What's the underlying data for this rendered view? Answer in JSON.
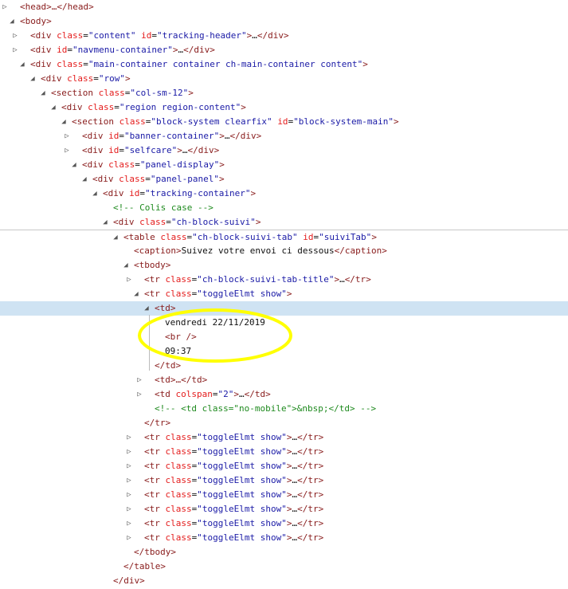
{
  "lines": [
    {
      "level": 0,
      "toggle": "closed",
      "text": "<head>…</head>"
    },
    {
      "level": 0,
      "toggle": "open",
      "text": "<body>"
    },
    {
      "level": 1,
      "toggle": "closed",
      "text": "<div class=\"content\" id=\"tracking-header\">…</div>"
    },
    {
      "level": 1,
      "toggle": "closed",
      "text": "<div id=\"navmenu-container\">…</div>"
    },
    {
      "level": 1,
      "toggle": "open",
      "text": "<div class=\"main-container container ch-main-container content\">"
    },
    {
      "level": 2,
      "toggle": "open",
      "text": "<div class=\"row\">"
    },
    {
      "level": 3,
      "toggle": "open",
      "text": "<section class=\"col-sm-12\">"
    },
    {
      "level": 4,
      "toggle": "open",
      "text": "<div class=\"region region-content\">"
    },
    {
      "level": 5,
      "toggle": "open",
      "text": "<section class=\"block-system clearfix\" id=\"block-system-main\">"
    },
    {
      "level": 6,
      "toggle": "closed",
      "text": "<div id=\"banner-container\">…</div>"
    },
    {
      "level": 6,
      "toggle": "closed",
      "text": "<div id=\"selfcare\">…</div>"
    },
    {
      "level": 6,
      "toggle": "open",
      "text": "<div class=\"panel-display\">"
    },
    {
      "level": 7,
      "toggle": "open",
      "text": "<div class=\"panel-panel\">"
    },
    {
      "level": 8,
      "toggle": "open",
      "text": "<div id=\"tracking-container\">"
    },
    {
      "level": 9,
      "toggle": "none",
      "text": "<!-- Colis case -->"
    },
    {
      "level": 9,
      "toggle": "open",
      "text": "<div class=\"ch-block-suivi\">"
    },
    {
      "level": 10,
      "toggle": "open",
      "text": "<table class=\"ch-block-suivi-tab\" id=\"suiviTab\">",
      "separator": true
    },
    {
      "level": 11,
      "toggle": "none",
      "text": "<caption>Suivez votre envoi ci dessous</caption>"
    },
    {
      "level": 11,
      "toggle": "open",
      "text": "<tbody>"
    },
    {
      "level": 12,
      "toggle": "closed",
      "text": "<tr class=\"ch-block-suivi-tab-title\">…</tr>"
    },
    {
      "level": 12,
      "toggle": "open",
      "text": "<tr class=\"toggleElmt show\">"
    },
    {
      "level": 13,
      "toggle": "open",
      "text": "<td>",
      "selected": true
    },
    {
      "level": 14,
      "toggle": "none",
      "text": "vendredi 22/11/2019"
    },
    {
      "level": 14,
      "toggle": "none",
      "text": "<br />"
    },
    {
      "level": 14,
      "toggle": "none",
      "text": "09:37"
    },
    {
      "level": 13,
      "toggle": "none",
      "text": "</td>"
    },
    {
      "level": 13,
      "toggle": "closed",
      "text": "<td>…</td>"
    },
    {
      "level": 13,
      "toggle": "closed",
      "text": "<td colspan=\"2\">…</td>"
    },
    {
      "level": 13,
      "toggle": "none",
      "text": "<!-- <td class=\"no-mobile\">&nbsp;</td> -->"
    },
    {
      "level": 12,
      "toggle": "none",
      "text": "</tr>"
    },
    {
      "level": 12,
      "toggle": "closed",
      "text": "<tr class=\"toggleElmt show\">…</tr>"
    },
    {
      "level": 12,
      "toggle": "closed",
      "text": "<tr class=\"toggleElmt show\">…</tr>"
    },
    {
      "level": 12,
      "toggle": "closed",
      "text": "<tr class=\"toggleElmt show\">…</tr>"
    },
    {
      "level": 12,
      "toggle": "closed",
      "text": "<tr class=\"toggleElmt show\">…</tr>"
    },
    {
      "level": 12,
      "toggle": "closed",
      "text": "<tr class=\"toggleElmt show\">…</tr>"
    },
    {
      "level": 12,
      "toggle": "closed",
      "text": "<tr class=\"toggleElmt show\">…</tr>"
    },
    {
      "level": 12,
      "toggle": "closed",
      "text": "<tr class=\"toggleElmt show\">…</tr>"
    },
    {
      "level": 12,
      "toggle": "closed",
      "text": "<tr class=\"toggleElmt show\">…</tr>"
    },
    {
      "level": 11,
      "toggle": "none",
      "text": "</tbody>"
    },
    {
      "level": 10,
      "toggle": "none",
      "text": "</table>"
    },
    {
      "level": 9,
      "toggle": "none",
      "text": "</div>"
    }
  ],
  "colors": {
    "tag": "#881b1b",
    "attr": "#e41c1c",
    "value": "#1a1aa6",
    "comment": "#1e8a1e",
    "selection": "#cfe3f3",
    "annotation": "#ffff00"
  }
}
